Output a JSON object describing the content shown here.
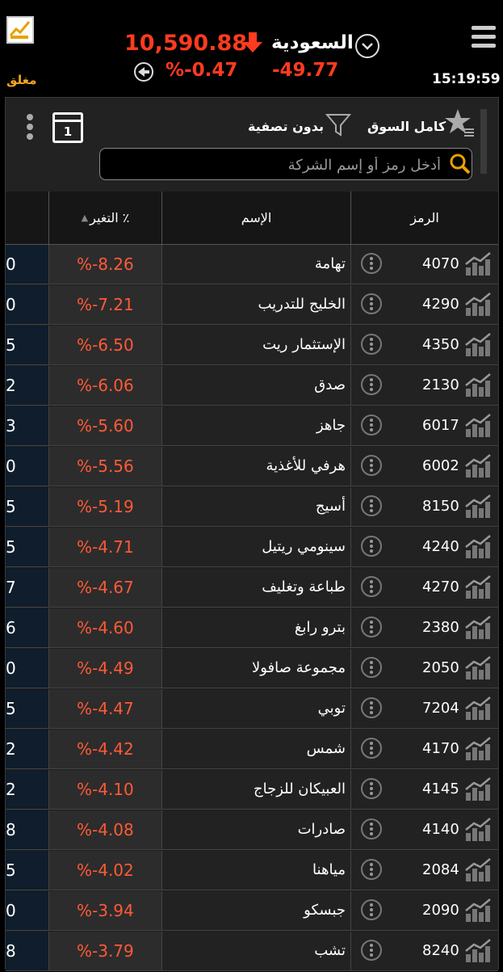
{
  "header": {
    "status": "مغلق",
    "index_value": "10,590.88",
    "market_name": "السعودية",
    "pct_change": "%-0.47",
    "abs_change": "-49.77",
    "time": "15:19:59",
    "colors": {
      "negative": "#ff3b1f",
      "status": "#f5a623"
    }
  },
  "filters": {
    "full_market": "كامل السوق",
    "no_filter": "بدون تصفية",
    "calendar_day": "1",
    "search_placeholder": "أدخل رمز أو إسم الشركة"
  },
  "table": {
    "headers": {
      "symbol": "الرمز",
      "name": "الإسم",
      "change": "التغير ٪"
    },
    "rows": [
      {
        "symbol": "4070",
        "name": "تهامة",
        "change": "%-8.26",
        "edge": "0"
      },
      {
        "symbol": "4290",
        "name": "الخليج للتدريب",
        "change": "%-7.21",
        "edge": "0"
      },
      {
        "symbol": "4350",
        "name": "الإستثمار ريت",
        "change": "%-6.50",
        "edge": "5"
      },
      {
        "symbol": "2130",
        "name": "صدق",
        "change": "%-6.06",
        "edge": "2"
      },
      {
        "symbol": "6017",
        "name": "جاهز",
        "change": "%-5.60",
        "edge": "3"
      },
      {
        "symbol": "6002",
        "name": "هرفي للأغذية",
        "change": "%-5.56",
        "edge": "0"
      },
      {
        "symbol": "8150",
        "name": "أسيج",
        "change": "%-5.19",
        "edge": "5"
      },
      {
        "symbol": "4240",
        "name": "سينومي ريتيل",
        "change": "%-4.71",
        "edge": "5"
      },
      {
        "symbol": "4270",
        "name": "طباعة وتغليف",
        "change": "%-4.67",
        "edge": "7"
      },
      {
        "symbol": "2380",
        "name": "بترو رابغ",
        "change": "%-4.60",
        "edge": "6"
      },
      {
        "symbol": "2050",
        "name": "مجموعة صافولا",
        "change": "%-4.49",
        "edge": "0"
      },
      {
        "symbol": "7204",
        "name": "توبي",
        "change": "%-4.47",
        "edge": "5"
      },
      {
        "symbol": "4170",
        "name": "شمس",
        "change": "%-4.42",
        "edge": "2"
      },
      {
        "symbol": "4145",
        "name": "العبيكان للزجاج",
        "change": "%-4.10",
        "edge": "2"
      },
      {
        "symbol": "4140",
        "name": "صادرات",
        "change": "%-4.08",
        "edge": "8"
      },
      {
        "symbol": "2084",
        "name": "مياهنا",
        "change": "%-4.02",
        "edge": "5"
      },
      {
        "symbol": "2090",
        "name": "جبسكو",
        "change": "%-3.94",
        "edge": "0"
      },
      {
        "symbol": "8240",
        "name": "تشب",
        "change": "%-3.79",
        "edge": "8"
      }
    ]
  }
}
